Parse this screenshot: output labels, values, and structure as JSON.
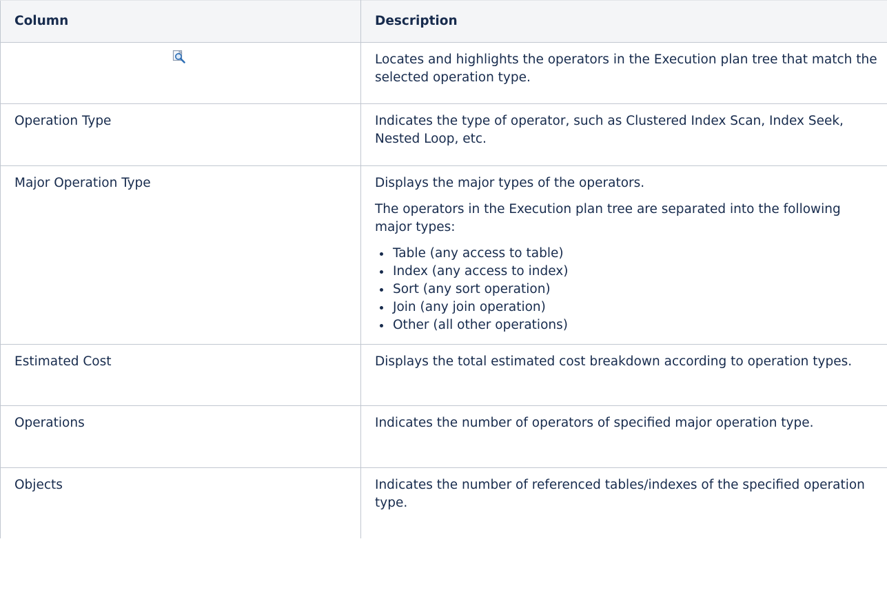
{
  "table": {
    "headers": [
      "Column",
      "Description"
    ],
    "rows": [
      {
        "column": "",
        "icon": "locate-magnifier-icon",
        "description": "Locates and highlights the operators in the Execution plan tree that match the selected operation type."
      },
      {
        "column": "Operation Type",
        "description": "Indicates the type of operator, such as Clustered Index Scan, Index Seek, Nested Loop, etc."
      },
      {
        "column": "Major Operation Type",
        "description": "Displays the major types of the operators.",
        "description_2": "The operators in the Execution plan tree are separated into the following major types:",
        "bullets": [
          "Table (any access to table)",
          "Index (any access to index)",
          "Sort (any sort operation)",
          "Join (any join operation)",
          "Other (all other operations)"
        ]
      },
      {
        "column": "Estimated Cost",
        "description": "Displays the total estimated cost breakdown according to operation types."
      },
      {
        "column": "Operations",
        "description": "Indicates the number of operators of specified major operation type."
      },
      {
        "column": "Objects",
        "description": "Indicates the number of referenced tables/indexes of the specified operation type."
      }
    ]
  },
  "colors": {
    "header_bg": "#f4f5f7",
    "border": "#c1c7d0",
    "text": "#172b4d",
    "icon_blue": "#2f6fb5"
  }
}
